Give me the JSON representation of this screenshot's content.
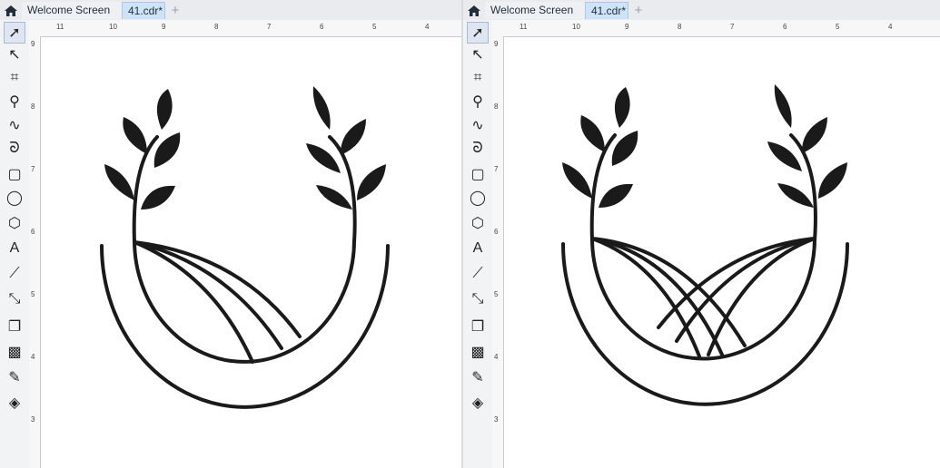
{
  "panes": [
    {
      "tabs": {
        "welcome": "Welcome Screen",
        "document": "41.cdr*",
        "new_tab": "+"
      },
      "hruler_labels": [
        "11",
        "10",
        "9",
        "8",
        "7",
        "6",
        "5",
        "4"
      ],
      "vruler_labels": [
        "9",
        "8",
        "7",
        "6",
        "5",
        "4",
        "3"
      ],
      "design": "logo-plants-over-curved-field"
    },
    {
      "tabs": {
        "welcome": "Welcome Screen",
        "document": "41.cdr*",
        "new_tab": "+"
      },
      "hruler_labels": [
        "11",
        "10",
        "9",
        "8",
        "7",
        "6",
        "5",
        "4"
      ],
      "vruler_labels": [
        "9",
        "8",
        "7",
        "6",
        "5",
        "4",
        "3"
      ],
      "design": "logo-plants-over-crossed-field"
    }
  ],
  "tools": [
    {
      "name": "pick-tool-icon",
      "glyph": "➚"
    },
    {
      "name": "shape-tool-icon",
      "glyph": "↖"
    },
    {
      "name": "crop-tool-icon",
      "glyph": "⌗"
    },
    {
      "name": "zoom-tool-icon",
      "glyph": "⚲"
    },
    {
      "name": "freehand-tool-icon",
      "glyph": "∿"
    },
    {
      "name": "artistic-media-icon",
      "glyph": "ᘐ"
    },
    {
      "name": "rectangle-tool-icon",
      "glyph": "▢"
    },
    {
      "name": "ellipse-tool-icon",
      "glyph": "◯"
    },
    {
      "name": "polygon-tool-icon",
      "glyph": "⬡"
    },
    {
      "name": "text-tool-icon",
      "glyph": "A"
    },
    {
      "name": "parallel-dimension-icon",
      "glyph": "⟋"
    },
    {
      "name": "connector-tool-icon",
      "glyph": "⤡"
    },
    {
      "name": "drop-shadow-icon",
      "glyph": "❐"
    },
    {
      "name": "transparency-icon",
      "glyph": "▩"
    },
    {
      "name": "eyedropper-icon",
      "glyph": "✎"
    },
    {
      "name": "interactive-fill-icon",
      "glyph": "◈"
    }
  ],
  "colors": {
    "ink": "#1a1a1a",
    "tab_active": "#cfe3f6",
    "chrome": "#e9ebee"
  }
}
